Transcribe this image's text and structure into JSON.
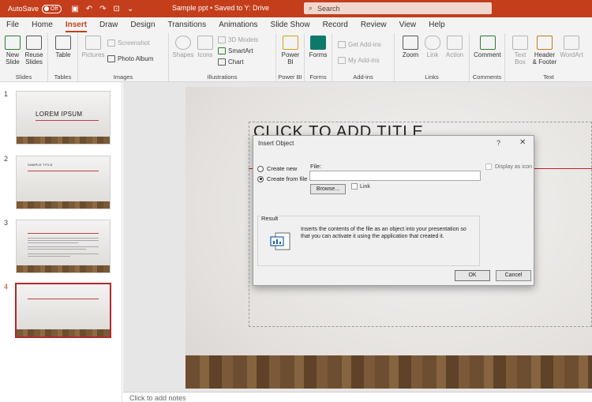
{
  "titlebar": {
    "autosave_label": "AutoSave",
    "autosave_state": "Off",
    "doc_title": "Sample ppt  •  Saved to Y: Drive",
    "search_placeholder": "Search"
  },
  "tabs": [
    "File",
    "Home",
    "Insert",
    "Draw",
    "Design",
    "Transitions",
    "Animations",
    "Slide Show",
    "Record",
    "Review",
    "View",
    "Help"
  ],
  "active_tab": "Insert",
  "ribbon": {
    "slides": {
      "label": "Slides",
      "new_slide": "New\nSlide",
      "reuse_slides": "Reuse\nSlides"
    },
    "tables": {
      "label": "Tables",
      "table": "Table"
    },
    "images": {
      "label": "Images",
      "pictures": "Pictures",
      "screenshot": "Screenshot",
      "photo_album": "Photo Album"
    },
    "illustrations": {
      "label": "Illustrations",
      "shapes": "Shapes",
      "icons": "Icons",
      "models_3d": "3D Models",
      "smartart": "SmartArt",
      "chart": "Chart"
    },
    "powerbi": {
      "label": "Power BI",
      "power_bi": "Power\nBI"
    },
    "forms": {
      "label": "Forms",
      "forms": "Forms"
    },
    "addins": {
      "label": "Add-ins",
      "get_addins": "Get Add-ins",
      "my_addins": "My Add-ins"
    },
    "links": {
      "label": "Links",
      "zoom": "Zoom",
      "link": "Link",
      "action": "Action"
    },
    "comments": {
      "label": "Comments",
      "comment": "Comment"
    },
    "text": {
      "label": "Text",
      "text_box": "Text\nBox",
      "header_footer": "Header\n& Footer",
      "wordart": "WordArt"
    }
  },
  "thumbnails": [
    {
      "num": "1",
      "title": "LOREM IPSUM"
    },
    {
      "num": "2",
      "title": "SAMPLE TITLE"
    },
    {
      "num": "3",
      "title": ""
    },
    {
      "num": "4",
      "title": ""
    }
  ],
  "slide": {
    "title_placeholder": "CLICK TO ADD TITLE",
    "notes_placeholder": "Click to add notes"
  },
  "dialog": {
    "title": "Insert Object",
    "help": "?",
    "close": "✕",
    "create_new": "Create new",
    "create_from_file": "Create from file",
    "file_label": "File:",
    "file_value": "",
    "browse": "Browse...",
    "link": "Link",
    "display_as_icon": "Display as icon",
    "result_label": "Result",
    "result_text": "Inserts the contents of the file as an object into your presentation so that you can activate it using the application that created it.",
    "ok": "OK",
    "cancel": "Cancel"
  },
  "colors": {
    "accent": "#c43e1c",
    "slide_line": "#b2282c"
  }
}
